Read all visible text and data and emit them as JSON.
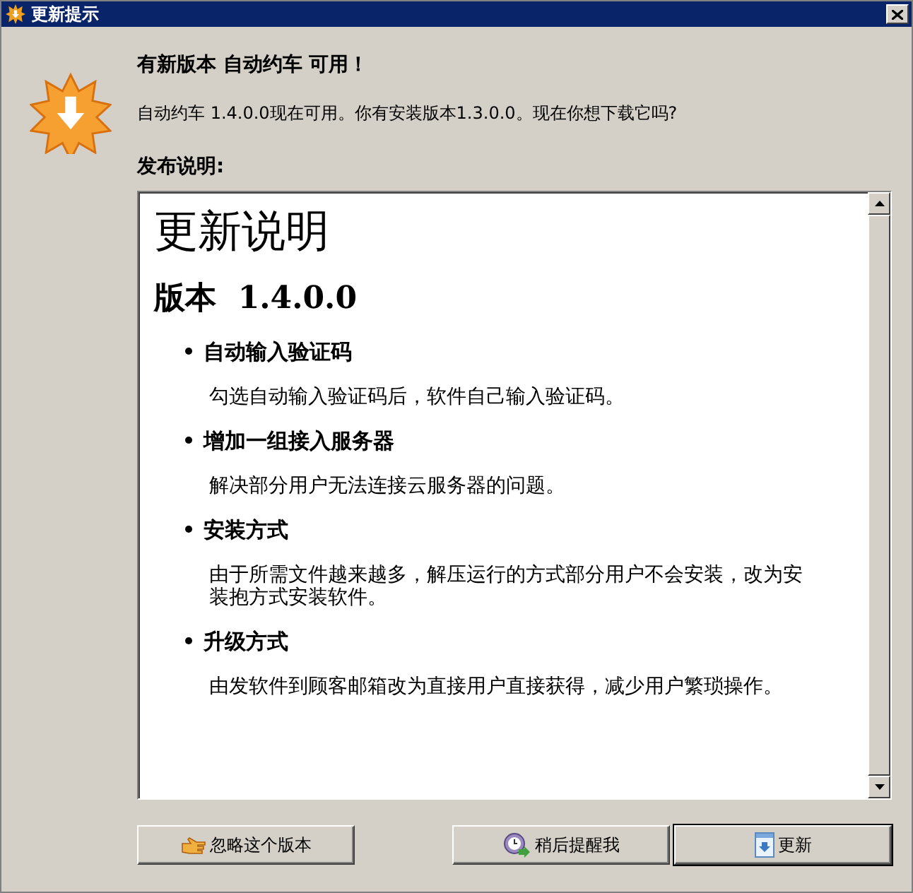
{
  "window": {
    "title": "更新提示"
  },
  "heading": "有新版本 自动约车 可用！",
  "message": "自动约车 1.4.0.0现在可用。你有安装版本1.3.0.0。现在你想下载它吗?",
  "notes_label": "发布说明:",
  "notes": {
    "title": "更新说明",
    "version": "版本  1.4.0.0",
    "items": [
      {
        "title": "自动输入验证码",
        "text": "勾选自动输入验证码后，软件自己输入验证码。"
      },
      {
        "title": "增加一组接入服务器",
        "text": "解决部分用户无法连接云服务器的问题。"
      },
      {
        "title": "安装方式",
        "text": "由于所需文件越来越多，解压运行的方式部分用户不会安装，改为安装抱方式安装软件。"
      },
      {
        "title": "升级方式",
        "text": "由发软件到顾客邮箱改为直接用户直接获得，减少用户繁琐操作。"
      }
    ]
  },
  "buttons": [
    {
      "label": "忽略这个版本",
      "kind": "ignore",
      "default": false
    },
    {
      "label": "稍后提醒我",
      "kind": "later",
      "default": false
    },
    {
      "label": "更新",
      "kind": "update",
      "default": true
    }
  ]
}
